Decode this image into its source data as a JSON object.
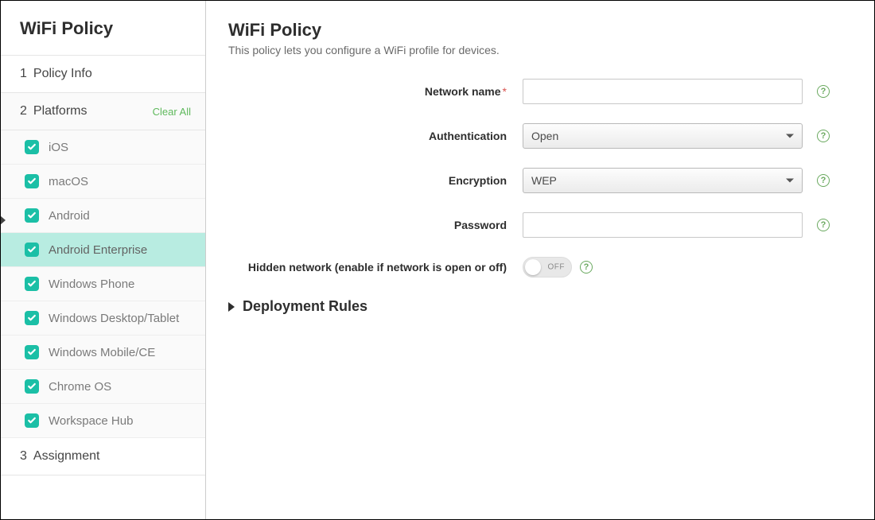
{
  "sidebar": {
    "title": "WiFi Policy",
    "steps": {
      "policyInfo": {
        "number": "1",
        "label": "Policy Info"
      },
      "platforms": {
        "number": "2",
        "label": "Platforms",
        "clear": "Clear All"
      },
      "assignment": {
        "number": "3",
        "label": "Assignment"
      }
    },
    "platforms": [
      {
        "label": "iOS",
        "selected": false
      },
      {
        "label": "macOS",
        "selected": false
      },
      {
        "label": "Android",
        "selected": false
      },
      {
        "label": "Android Enterprise",
        "selected": true
      },
      {
        "label": "Windows Phone",
        "selected": false
      },
      {
        "label": "Windows Desktop/Tablet",
        "selected": false
      },
      {
        "label": "Windows Mobile/CE",
        "selected": false
      },
      {
        "label": "Chrome OS",
        "selected": false
      },
      {
        "label": "Workspace Hub",
        "selected": false
      }
    ]
  },
  "main": {
    "title": "WiFi Policy",
    "subtitle": "This policy lets you configure a WiFi profile for devices.",
    "fields": {
      "networkName": {
        "label": "Network name",
        "required": true,
        "value": ""
      },
      "authentication": {
        "label": "Authentication",
        "value": "Open"
      },
      "encryption": {
        "label": "Encryption",
        "value": "WEP"
      },
      "password": {
        "label": "Password",
        "value": ""
      },
      "hiddenNetwork": {
        "label": "Hidden network (enable if network is open or off)",
        "value": "OFF"
      }
    },
    "deploymentRules": {
      "label": "Deployment Rules"
    }
  }
}
